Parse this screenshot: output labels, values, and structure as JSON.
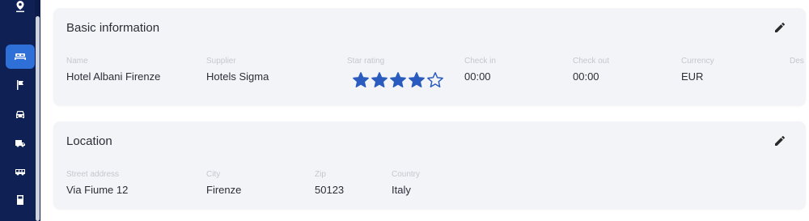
{
  "sidebar": {
    "items": [
      {
        "icon": "pin-icon"
      },
      {
        "icon": "hotel-bed-icon",
        "active": true
      },
      {
        "icon": "flag-icon"
      },
      {
        "icon": "car-icon"
      },
      {
        "icon": "truck-icon"
      },
      {
        "icon": "bus-icon"
      },
      {
        "icon": "book-icon"
      }
    ]
  },
  "basic": {
    "title": "Basic information",
    "fields": {
      "name_label": "Name",
      "name_value": "Hotel Albani Firenze",
      "supplier_label": "Supplier",
      "supplier_value": "Hotels Sigma",
      "star_label": "Star rating",
      "checkin_label": "Check in",
      "checkin_value": "00:00",
      "checkout_label": "Check out",
      "checkout_value": "00:00",
      "currency_label": "Currency",
      "currency_value": "EUR",
      "desc_label": "Des"
    },
    "star_rating": 4,
    "star_max": 5
  },
  "location": {
    "title": "Location",
    "fields": {
      "street_label": "Street address",
      "street_value": "Via Fiume 12",
      "city_label": "City",
      "city_value": "Firenze",
      "zip_label": "Zip",
      "zip_value": "50123",
      "country_label": "Country",
      "country_value": "Italy"
    }
  },
  "colors": {
    "sidebar": "#0f2154",
    "active": "#2f6fd8",
    "star": "#2a5bbf"
  }
}
